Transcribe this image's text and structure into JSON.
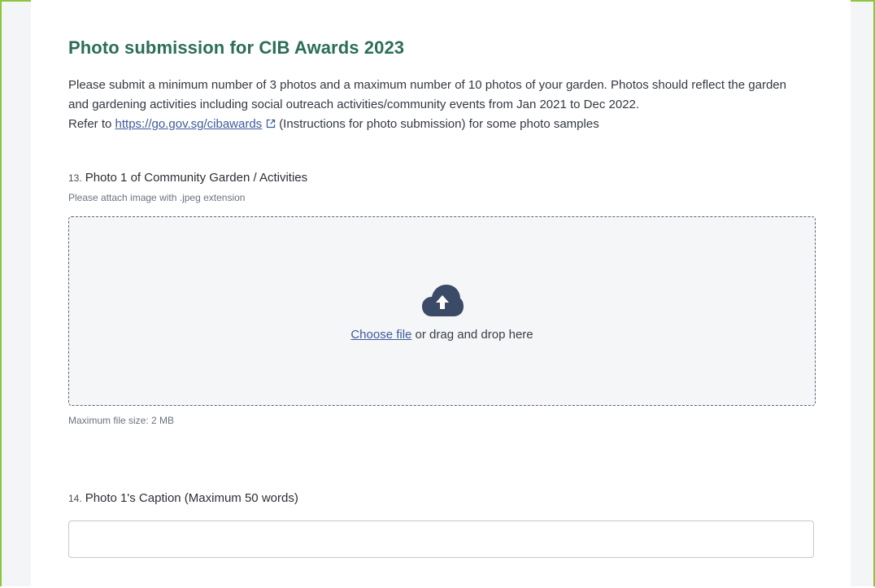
{
  "section": {
    "title": "Photo submission for CIB Awards 2023",
    "description_line1": "Please submit a minimum number of 3 photos and a maximum number of 10 photos of your garden. Photos should reflect the garden and gardening activities including social outreach activities/community events from Jan 2021 to Dec 2022.",
    "refer_prefix": "Refer to ",
    "refer_link": "https://go.gov.sg/cibawards",
    "refer_suffix": "(Instructions for photo submission) for some photo samples"
  },
  "question13": {
    "number": "13.",
    "label": "Photo 1 of Community Garden / Activities",
    "hint": "Please attach image with .jpeg extension",
    "choose_file": "Choose file",
    "drop_text": " or drag and drop here",
    "max_size": "Maximum file size: 2 MB"
  },
  "question14": {
    "number": "14.",
    "label": "Photo 1's Caption (Maximum 50 words)",
    "value": ""
  },
  "colors": {
    "frame_border": "#8cc63f",
    "title": "#2c6e58",
    "link": "#3d5b9a",
    "upload_icon": "#3b4a66"
  },
  "icons": {
    "external_link": "external-link-icon",
    "upload": "cloud-upload-icon"
  }
}
